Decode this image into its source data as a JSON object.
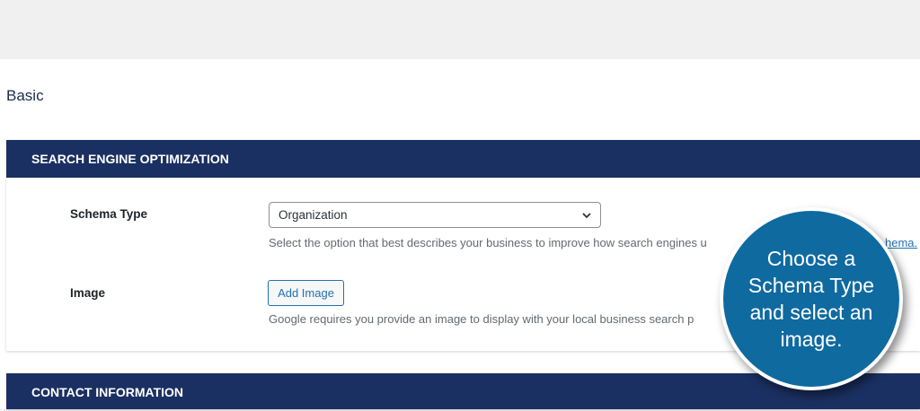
{
  "page": {
    "heading": "Basic"
  },
  "seo_panel": {
    "title": "SEARCH ENGINE OPTIMIZATION",
    "schema_type": {
      "label": "Schema Type",
      "selected": "Organization",
      "help_text": "Select the option that best describes your business to improve how search engines u",
      "help_link": "hema."
    },
    "image": {
      "label": "Image",
      "button_label": "Add Image",
      "help_text": "Google requires you provide an image to display with your local business search p"
    }
  },
  "contact_panel": {
    "title": "CONTACT INFORMATION"
  },
  "callout": {
    "lines": [
      "Choose a",
      "Schema Type",
      "and select an",
      "image."
    ]
  },
  "colors": {
    "panel_header": "#1b3062",
    "callout": "#0f6aa0",
    "link": "#2271b1"
  },
  "icons": {
    "select_arrow": "chevron-down-icon"
  }
}
